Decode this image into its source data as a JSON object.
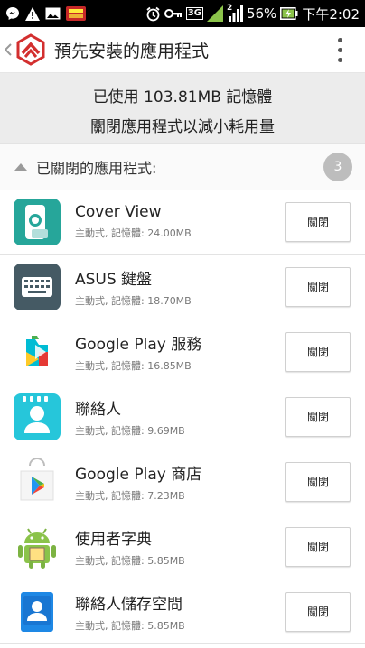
{
  "statusbar": {
    "network_badge": "3G",
    "sim_label": "2",
    "battery": "56%",
    "time": "下午2:02",
    "icons": [
      "messenger-icon",
      "warning-icon",
      "gallery-icon",
      "store-badge-icon",
      "alarm-icon",
      "key-icon",
      "signal-icon",
      "battery-charging-icon"
    ]
  },
  "appbar": {
    "title": "預先安裝的應用程式",
    "icons": [
      "back-chevron-icon",
      "app-logo-icon",
      "overflow-menu-icon"
    ]
  },
  "summary": {
    "line1": "已使用 103.81MB 記憶體",
    "line2": "關閉應用程式以減小耗用量"
  },
  "section": {
    "title": "已關閉的應用程式:",
    "count": "3"
  },
  "apps": [
    {
      "name": "Cover View",
      "sub": "主動式, 記憶體: 24.00MB",
      "button": "關閉",
      "icon": "cover-view-icon"
    },
    {
      "name": "ASUS 鍵盤",
      "sub": "主動式, 記憶體: 18.70MB",
      "button": "關閉",
      "icon": "keyboard-icon"
    },
    {
      "name": "Google Play 服務",
      "sub": "主動式, 記憶體: 16.85MB",
      "button": "關閉",
      "icon": "play-services-icon"
    },
    {
      "name": "聯絡人",
      "sub": "主動式, 記憶體: 9.69MB",
      "button": "關閉",
      "icon": "contacts-icon"
    },
    {
      "name": "Google Play 商店",
      "sub": "主動式, 記憶體: 7.23MB",
      "button": "關閉",
      "icon": "play-store-icon"
    },
    {
      "name": "使用者字典",
      "sub": "主動式, 記憶體: 5.85MB",
      "button": "關閉",
      "icon": "android-dictionary-icon"
    },
    {
      "name": "聯絡人儲存空間",
      "sub": "主動式, 記憶體: 5.85MB",
      "button": "關閉",
      "icon": "contacts-storage-icon"
    }
  ],
  "colors": {
    "accent": "#d32f2f",
    "summary_bg": "#ececec",
    "badge": "#bdbdbd"
  }
}
